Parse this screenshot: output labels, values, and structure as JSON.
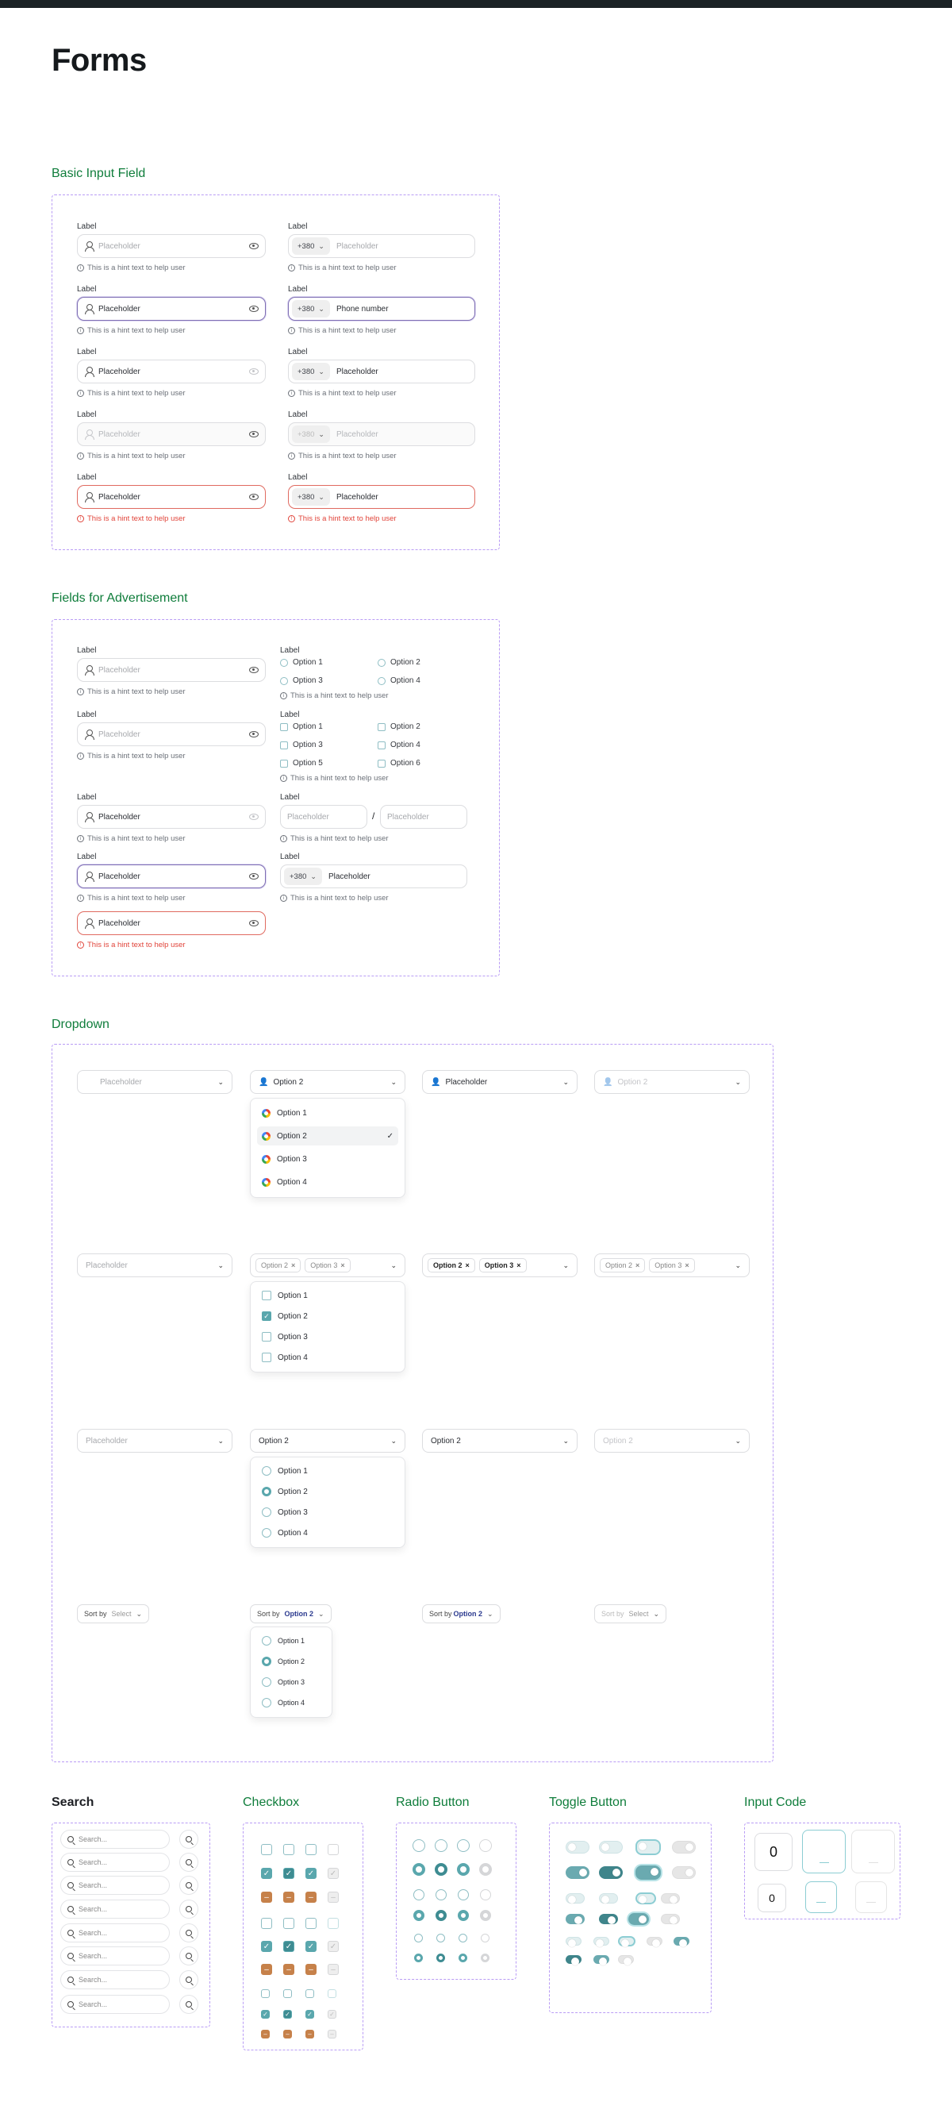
{
  "page_title": "Forms",
  "sections": {
    "basic": "Basic Input Field",
    "ads": "Fields for Advertisement",
    "dropdown": "Dropdown",
    "search": "Search",
    "checkbox": "Checkbox",
    "radio": "Radio Button",
    "toggle": "Toggle Button",
    "code": "Input Code"
  },
  "common": {
    "label": "Label",
    "placeholder": "Placeholder",
    "hint": "This is a hint text to help user",
    "country_code": "+380",
    "phone_number": "Phone number",
    "option1": "Option 1",
    "option2": "Option 2",
    "option3": "Option 3",
    "option4": "Option 4",
    "option5": "Option 5",
    "option6": "Option 6",
    "sort_by": "Sort by",
    "sort_by_nospace": "Sort by",
    "select": "Select",
    "search": "Search...",
    "code_zero": "0"
  },
  "colors": {
    "accent_teal": "#5aa7ad",
    "accent_orange": "#c6814a",
    "section_green": "#0f7d3b",
    "error": "#e1443a",
    "frame_dashed": "#b99cf5"
  }
}
